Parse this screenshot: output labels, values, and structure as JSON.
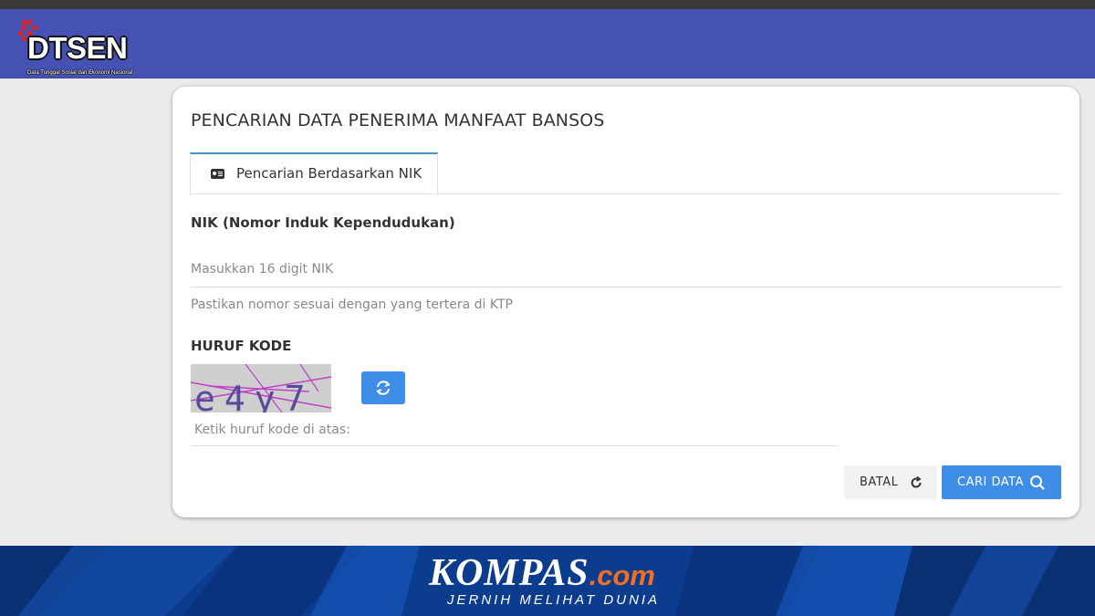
{
  "header": {
    "logo_text": "DTSEN",
    "logo_subtitle": "Data Tunggal Sosial dan Ekonomi Nasional"
  },
  "card": {
    "title": "PENCARIAN DATA PENERIMA MANFAAT BANSOS"
  },
  "tabs": [
    {
      "label": "Pencarian Berdasarkan NIK",
      "icon": "id-card-icon",
      "active": true
    }
  ],
  "form": {
    "nik_label": "NIK (Nomor Induk Kependudukan)",
    "nik_value": "",
    "nik_placeholder": "Masukkan 16 digit NIK",
    "nik_help": "Pastikan nomor sesuai dengan yang tertera di KTP",
    "kode_label": "HURUF KODE",
    "captcha_text": "e4y7",
    "kode_value": "",
    "kode_placeholder": "Ketik huruf kode di atas:"
  },
  "buttons": {
    "batal_label": "BATAL",
    "cari_label": "CARI DATA"
  },
  "footer": {
    "brand": "KOMPAS",
    "brand_suffix": ".com",
    "tagline": "JERNIH MELIHAT DUNIA"
  },
  "colors": {
    "header_bg": "#4652b3",
    "primary_button": "#3e8ee8",
    "tab_accent": "#3f8fd8",
    "footer_bg": "#0c3c8e",
    "brand_accent": "#f26f21"
  }
}
